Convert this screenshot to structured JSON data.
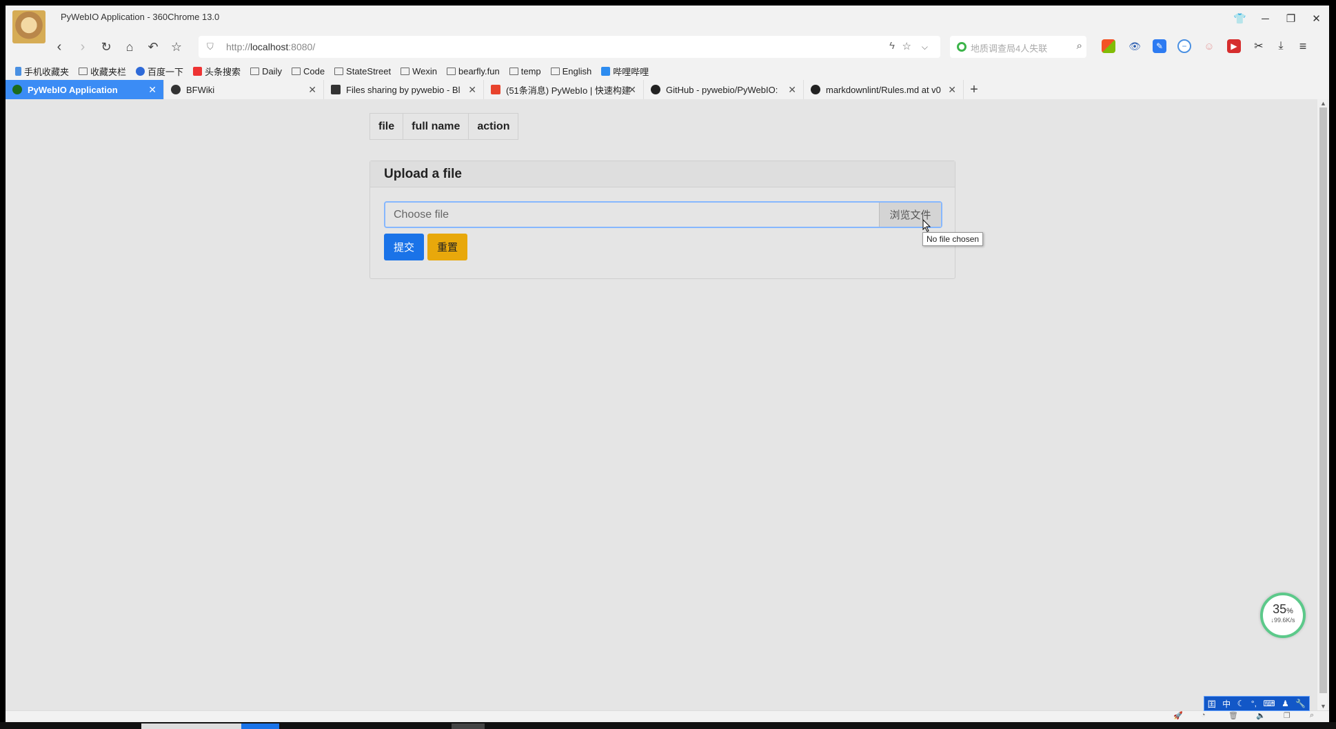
{
  "window": {
    "title": "PyWebIO Application - 360Chrome 13.0"
  },
  "address": {
    "url_prefix": "http://",
    "url_host": "localhost",
    "url_suffix": ":8080/"
  },
  "search": {
    "placeholder": "地质调查局4人失联"
  },
  "bookmarks": [
    {
      "label": "手机收藏夹",
      "icon": "phone-bookmark-icon"
    },
    {
      "label": "收藏夹栏",
      "icon": "folder-icon"
    },
    {
      "label": "百度一下",
      "icon": "baidu-icon"
    },
    {
      "label": "头条搜索",
      "icon": "toutiao-icon"
    },
    {
      "label": "Daily",
      "icon": "folder-icon"
    },
    {
      "label": "Code",
      "icon": "folder-icon"
    },
    {
      "label": "StateStreet",
      "icon": "folder-icon"
    },
    {
      "label": "Wexin",
      "icon": "folder-icon"
    },
    {
      "label": "bearfly.fun",
      "icon": "folder-icon"
    },
    {
      "label": "temp",
      "icon": "folder-icon"
    },
    {
      "label": "English",
      "icon": "folder-icon"
    },
    {
      "label": "哔哩哔哩",
      "icon": "bilibili-icon"
    }
  ],
  "tabs": [
    {
      "label": "PyWebIO Application",
      "active": true,
      "color": "#1b6b1b"
    },
    {
      "label": "BFWiki",
      "active": false,
      "color": "#333333"
    },
    {
      "label": "Files sharing by pywebio - Bl",
      "active": false,
      "color": "#333333"
    },
    {
      "label": "(51条消息) PyWebIo | 快速构建",
      "active": false,
      "color": "#e8432d"
    },
    {
      "label": "GitHub - pywebio/PyWebIO:",
      "active": false,
      "color": "#222222"
    },
    {
      "label": "markdownlint/Rules.md at v0",
      "active": false,
      "color": "#222222"
    }
  ],
  "table": {
    "headers": [
      "file",
      "full name",
      "action"
    ]
  },
  "upload": {
    "title": "Upload a file",
    "placeholder": "Choose file",
    "browse_label": "浏览文件",
    "tooltip": "No file chosen",
    "submit_label": "提交",
    "reset_label": "重置"
  },
  "netmon": {
    "percent": "35",
    "percent_unit": "%",
    "speed": "↓99.6K/s"
  },
  "ime": {
    "mode_label": "中"
  },
  "colors": {
    "accent": "#1a73e8",
    "reset": "#e8a80b",
    "active_tab": "#3b8cf5"
  }
}
